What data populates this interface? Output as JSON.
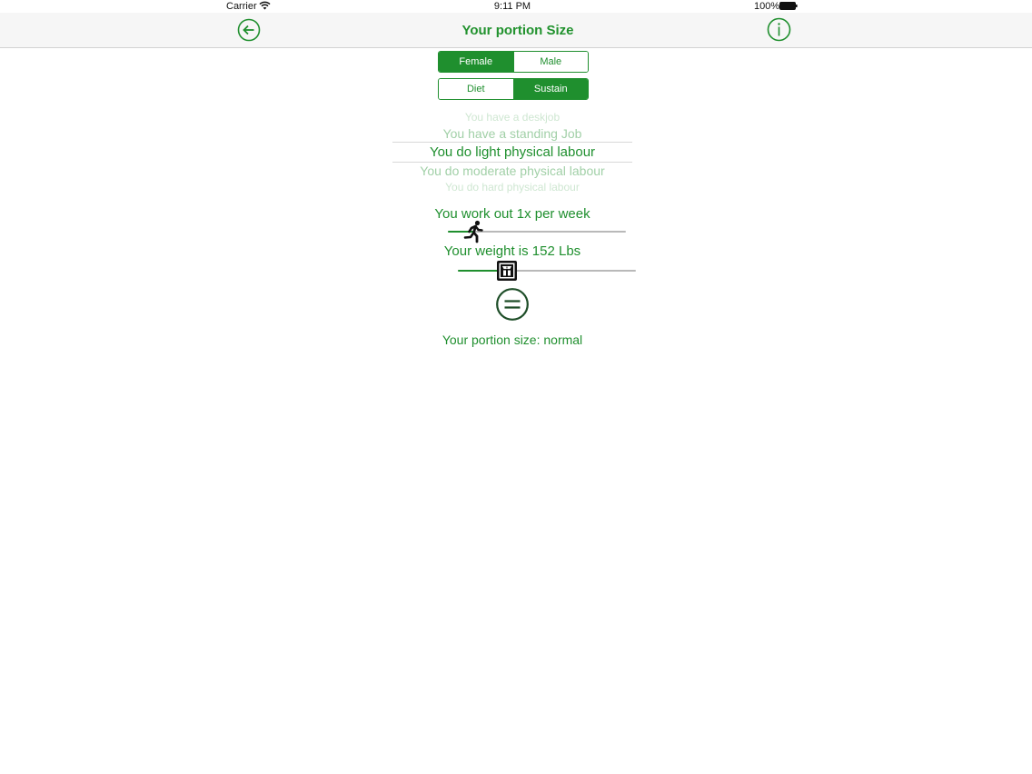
{
  "status_bar": {
    "carrier": "Carrier",
    "time": "9:11 PM",
    "battery": "100%"
  },
  "nav": {
    "title": "Your portion Size",
    "back_icon": "arrow-left-circle-icon",
    "info_icon": "info-circle-icon"
  },
  "gender_segment": {
    "options": [
      "Female",
      "Male"
    ],
    "selected": "Female"
  },
  "goal_segment": {
    "options": [
      "Diet",
      "Sustain"
    ],
    "selected": "Sustain"
  },
  "activity_picker": {
    "rows": [
      "You have a deskjob",
      "You have a standing Job",
      "You do light physical labour",
      "You do moderate physical labour",
      "You do hard physical labour"
    ],
    "selected_index": 2
  },
  "workout": {
    "label": "You work out 1x per week",
    "value": 1,
    "min": 0,
    "max": 7,
    "icon": "runner-icon"
  },
  "weight": {
    "label": "Your weight is 152 Lbs",
    "value": 152,
    "min": 70,
    "max": 370,
    "icon": "scale-icon"
  },
  "calculate": {
    "icon": "equals-circle-icon"
  },
  "result": {
    "label": "Your portion size: normal"
  },
  "colors": {
    "accent": "#1f8f2e",
    "nav_background": "#f6f6f6",
    "track": "#b9b9b9"
  }
}
